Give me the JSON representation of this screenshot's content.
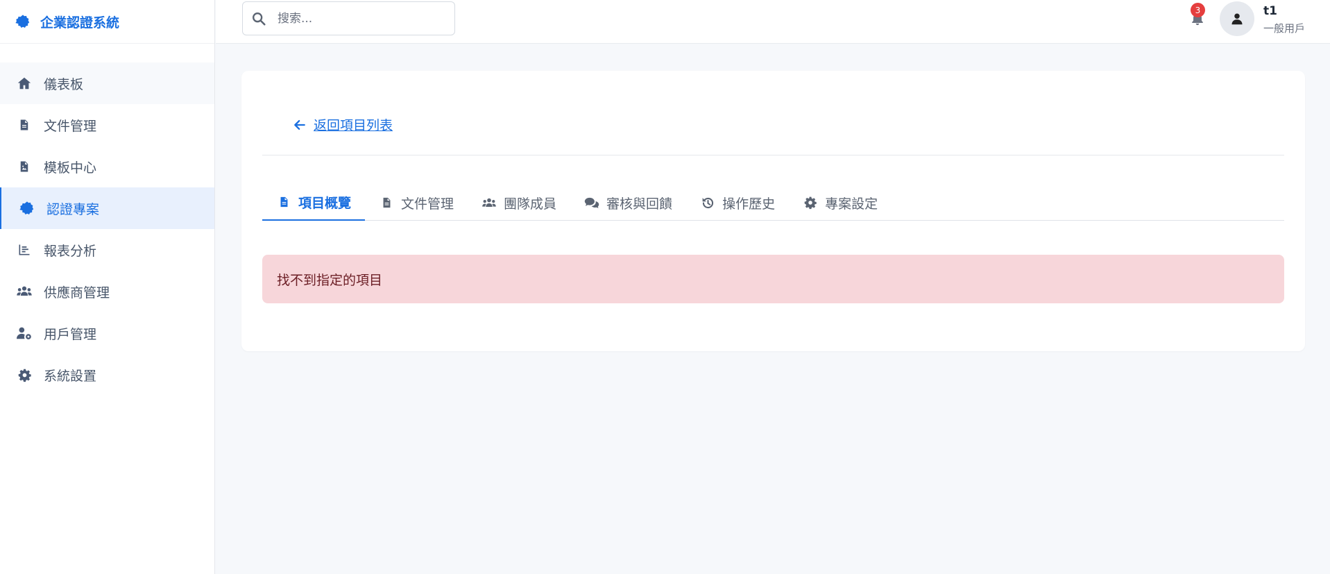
{
  "brand": {
    "title": "企業認證系統",
    "icon": "badge-icon",
    "color": "#1a6fe0"
  },
  "sidebar": {
    "items": [
      {
        "label": "儀表板",
        "icon": "home-icon"
      },
      {
        "label": "文件管理",
        "icon": "file-icon"
      },
      {
        "label": "模板中心",
        "icon": "file-image-icon"
      },
      {
        "label": "認證專案",
        "icon": "certificate-icon",
        "active": true
      },
      {
        "label": "報表分析",
        "icon": "chart-icon"
      },
      {
        "label": "供應商管理",
        "icon": "users-icon"
      },
      {
        "label": "用戶管理",
        "icon": "user-gear-icon"
      },
      {
        "label": "系統設置",
        "icon": "gear-icon"
      }
    ]
  },
  "header": {
    "search": {
      "placeholder": "搜索..."
    },
    "notifications": {
      "count": "3"
    },
    "user": {
      "name": "t1",
      "role": "一般用戶"
    }
  },
  "main": {
    "back_label": "返回項目列表",
    "tabs": [
      {
        "label": "項目概覽",
        "icon": "file-icon",
        "active": true
      },
      {
        "label": "文件管理",
        "icon": "file-icon"
      },
      {
        "label": "團隊成員",
        "icon": "users-icon"
      },
      {
        "label": "審核與回饋",
        "icon": "comments-icon"
      },
      {
        "label": "操作歷史",
        "icon": "history-icon"
      },
      {
        "label": "專案設定",
        "icon": "gear-icon"
      }
    ],
    "alert": {
      "message": "找不到指定的項目",
      "background": "#f7d6da"
    }
  }
}
